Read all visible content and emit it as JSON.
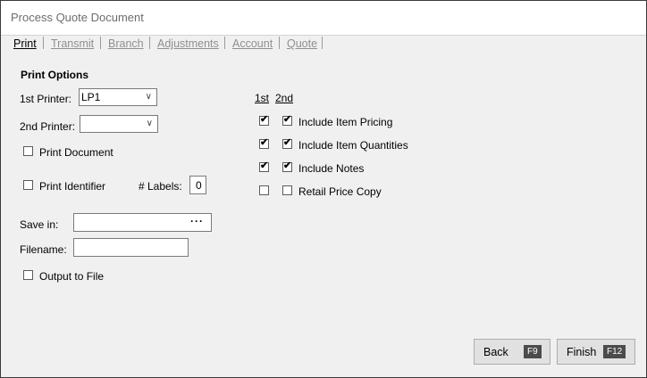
{
  "window": {
    "title": "Process Quote Document"
  },
  "tabs": [
    {
      "label": "Print",
      "active": true
    },
    {
      "label": "Transmit",
      "active": false
    },
    {
      "label": "Branch",
      "active": false
    },
    {
      "label": "Adjustments",
      "active": false
    },
    {
      "label": "Account",
      "active": false
    },
    {
      "label": "Quote",
      "active": false
    }
  ],
  "print_options": {
    "heading": "Print Options",
    "printer1_label": "1st Printer:",
    "printer1_value": "LP1",
    "printer2_label": "2nd Printer:",
    "printer2_value": "",
    "print_document_label": "Print Document",
    "print_document_checked": false,
    "print_identifier_label": "Print Identifier",
    "print_identifier_checked": false,
    "labels_label": "# Labels:",
    "labels_value": "0"
  },
  "columns": {
    "first": "1st",
    "second": "2nd"
  },
  "include_options": [
    {
      "label": "Include Item Pricing",
      "first": true,
      "second": true
    },
    {
      "label": "Include Item Quantities",
      "first": true,
      "second": true
    },
    {
      "label": "Include Notes",
      "first": true,
      "second": true
    },
    {
      "label": "Retail Price Copy",
      "first": false,
      "second": false
    }
  ],
  "save": {
    "save_in_label": "Save in:",
    "save_in_value": "",
    "browse_label": "···",
    "filename_label": "Filename:",
    "filename_value": "",
    "output_to_file_label": "Output to File",
    "output_to_file_checked": false
  },
  "buttons": {
    "back_label": "Back",
    "back_key": "F9",
    "finish_label": "Finish",
    "finish_key": "F12"
  },
  "icons": {
    "check": "✔",
    "chevron": "∨"
  }
}
